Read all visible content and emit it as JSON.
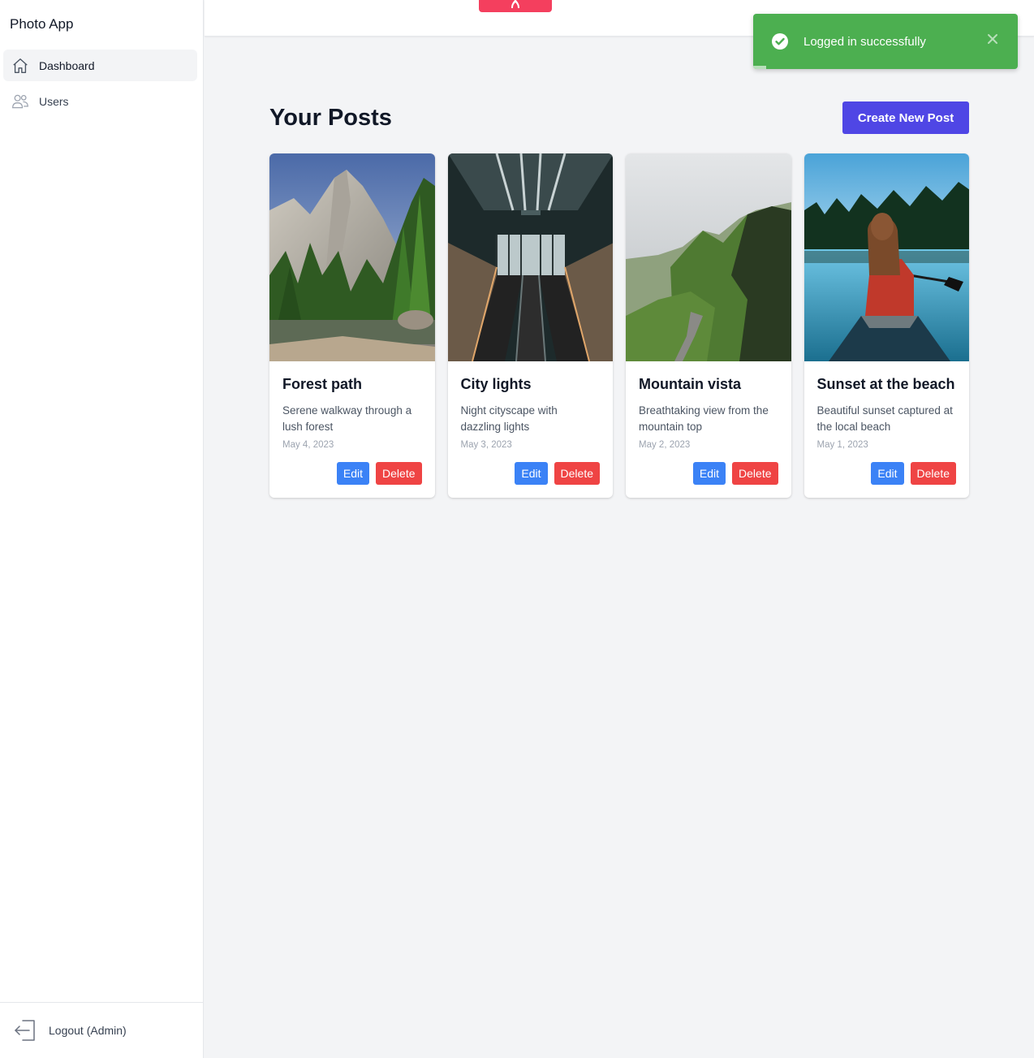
{
  "app": {
    "title": "Photo App"
  },
  "sidebar": {
    "items": [
      {
        "label": "Dashboard",
        "icon": "home-icon",
        "active": true
      },
      {
        "label": "Users",
        "icon": "users-icon",
        "active": false
      }
    ],
    "logout_label": "Logout (Admin)"
  },
  "header": {
    "title": "Your Posts",
    "create_label": "Create New Post"
  },
  "posts": [
    {
      "title": "Forest path",
      "description": "Serene walkway through a lush forest",
      "date": "May 4, 2023",
      "image": "forest-mountain-photo",
      "edit_label": "Edit",
      "delete_label": "Delete"
    },
    {
      "title": "City lights",
      "description": "Night cityscape with dazzling lights",
      "date": "May 3, 2023",
      "image": "escalator-station-photo",
      "edit_label": "Edit",
      "delete_label": "Delete"
    },
    {
      "title": "Mountain vista",
      "description": "Breathtaking view from the mountain top",
      "date": "May 2, 2023",
      "image": "green-mountain-road-photo",
      "edit_label": "Edit",
      "delete_label": "Delete"
    },
    {
      "title": "Sunset at the beach",
      "description": "Beautiful sunset captured at the local beach",
      "date": "May 1, 2023",
      "image": "woman-in-canoe-photo",
      "edit_label": "Edit",
      "delete_label": "Delete"
    }
  ],
  "toast": {
    "message": "Logged in successfully",
    "type": "success",
    "progress": 0.05
  },
  "colors": {
    "primary": "#4f46e5",
    "edit": "#3b82f6",
    "delete": "#ef4444",
    "success": "#4caf50",
    "top_tab": "#f43f5e"
  }
}
